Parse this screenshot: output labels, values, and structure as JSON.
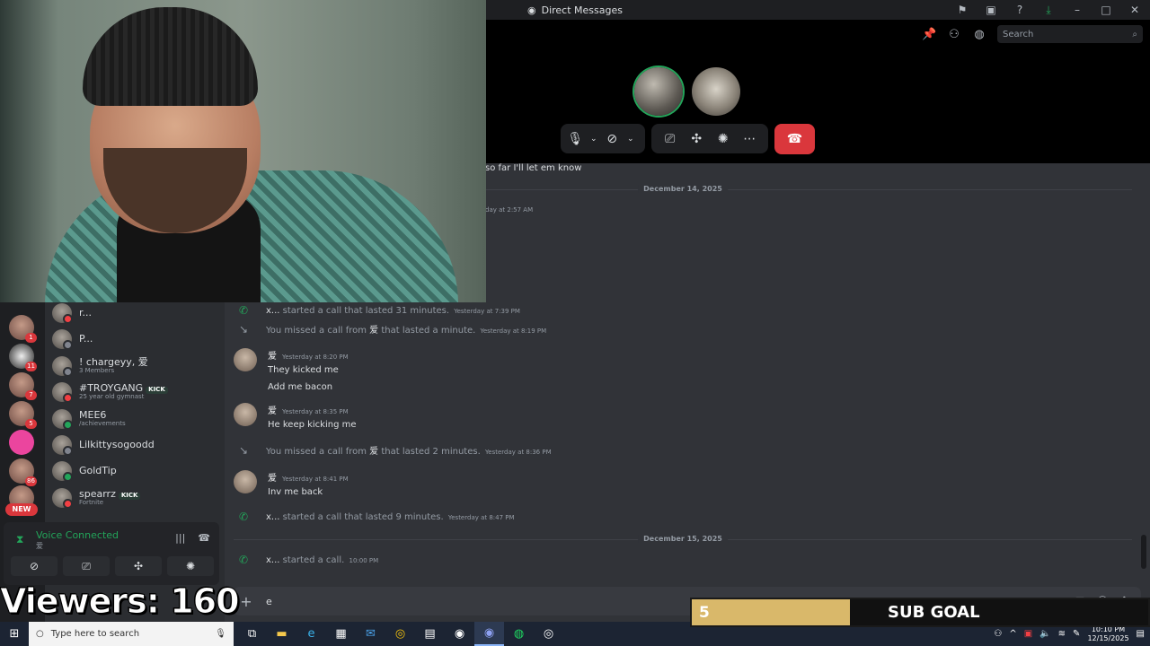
{
  "titlebar": {
    "title": "Direct Messages"
  },
  "call_toolbar": {
    "search_placeholder": "Search"
  },
  "overlay": {
    "viewers": "Viewers: 160",
    "subgoal_count": "5",
    "subgoal_label": "SUB GOAL"
  },
  "rail": {
    "badges": [
      "1",
      "11",
      "7",
      "5",
      "86"
    ],
    "new_label": "NEW"
  },
  "dms": [
    {
      "name": "r...",
      "sub": ""
    },
    {
      "name": "P...",
      "sub": ""
    },
    {
      "name": "! chargeyy, 爱",
      "sub": "3 Members"
    },
    {
      "name": "#TROYGANG",
      "badge": "KICK",
      "sub": "25 year old gymnast"
    },
    {
      "name": "MEE6",
      "sub": "/achievements"
    },
    {
      "name": "Lilkittysogoodd",
      "sub": ""
    },
    {
      "name": "GoldTip",
      "sub": ""
    },
    {
      "name": "spearrz",
      "badge": "KICK",
      "sub": "Fortnite"
    }
  ],
  "voice": {
    "status": "Voice Connected",
    "channel": "爱"
  },
  "messages": {
    "fragment": "so far I'll let em know",
    "fragment_ts": "day at 2:57 AM",
    "date1": "December 14, 2025",
    "date2": "December 15, 2025",
    "call1": {
      "user": "x...",
      "text": "started a call that lasted 31 minutes.",
      "ts": "Yesterday at 7:39 PM"
    },
    "missed1": {
      "pre": "You missed a call from",
      "user": "爱",
      "post": "that lasted a minute.",
      "ts": "Yesterday at 8:19 PM"
    },
    "msg1": {
      "author": "爱",
      "ts": "Yesterday at 8:20 PM",
      "line1": "They kicked me",
      "line2": "Add me bacon"
    },
    "msg2": {
      "author": "爱",
      "ts": "Yesterday at 8:35 PM",
      "line1": "He keep kicking me"
    },
    "missed2": {
      "pre": "You missed a call from",
      "user": "爱",
      "post": "that lasted 2 minutes.",
      "ts": "Yesterday at 8:36 PM"
    },
    "msg3": {
      "author": "爱",
      "ts": "Yesterday at 8:41 PM",
      "line1": "Inv me back"
    },
    "call2": {
      "user": "x...",
      "text": "started a call that lasted 9 minutes.",
      "ts": "Yesterday at 8:47 PM"
    },
    "call3": {
      "user": "x...",
      "text": "started a call.",
      "ts": "10:00 PM"
    }
  },
  "composer": {
    "value": "e"
  },
  "taskbar": {
    "search_placeholder": "Type here to search",
    "time": "10:10 PM",
    "date": "12/15/2025"
  }
}
